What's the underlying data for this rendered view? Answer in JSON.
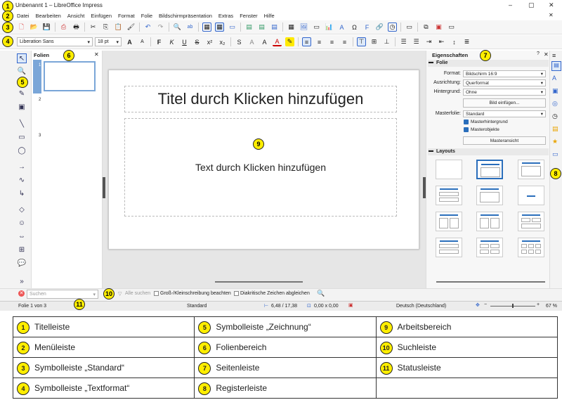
{
  "window": {
    "title": "Unbenannt 1 – LibreOffice Impress",
    "controls": [
      "–",
      "▢",
      "✕"
    ]
  },
  "menu": [
    "Datei",
    "Bearbeiten",
    "Ansicht",
    "Einfügen",
    "Format",
    "Folie",
    "Bildschirmpräsentation",
    "Extras",
    "Fenster",
    "Hilfe"
  ],
  "textformat": {
    "font": "Liberation Sans",
    "size": "18 pt"
  },
  "slidepane": {
    "title": "Folien",
    "numbers": [
      "1",
      "2",
      "3"
    ]
  },
  "slide": {
    "title_placeholder": "Titel durch Klicken hinzufügen",
    "text_placeholder": "Text durch Klicken hinzufügen"
  },
  "sidebar": {
    "title": "Eigenschaften",
    "folie_header": "Folie",
    "format_label": "Format:",
    "format_value": "Bildschirm 16:9",
    "ausrichtung_label": "Ausrichtung:",
    "ausrichtung_value": "Querformat",
    "hintergrund_label": "Hintergrund:",
    "hintergrund_value": "Ohne",
    "bild_button": "Bild einfügen...",
    "masterfolie_label": "Masterfolie:",
    "masterfolie_value": "Standard",
    "check1": "Masterhintergrund",
    "check2": "Masterobjekte",
    "masteransicht_button": "Masteransicht",
    "layouts_header": "Layouts"
  },
  "findbar": {
    "placeholder": "Suchen",
    "alle_suchen": "Alle suchen",
    "opt1": "Groß-/Kleinschreibung beachten",
    "opt2": "Diakritische Zeichen abgleichen"
  },
  "status": {
    "slide": "Folie 1 von 3",
    "master": "Standard",
    "pos": "6,48 / 17,38",
    "size": "0,00 x 0,00",
    "lang": "Deutsch (Deutschland)",
    "zoom": "67 %"
  },
  "badges": [
    "1",
    "2",
    "3",
    "4",
    "5",
    "6",
    "7",
    "8",
    "9",
    "10",
    "11"
  ],
  "legend": [
    [
      "Titelleiste",
      "Symbolleiste „Zeichnung“",
      "Arbeitsbereich"
    ],
    [
      "Menüleiste",
      "Folienbereich",
      "Suchleiste"
    ],
    [
      "Symbolleiste „Standard“",
      "Seitenleiste",
      "Statusleiste"
    ],
    [
      "Symbolleiste „Textformat“",
      "Registerleiste",
      ""
    ]
  ],
  "legend_nums": [
    [
      "1",
      "5",
      "9"
    ],
    [
      "2",
      "6",
      "10"
    ],
    [
      "3",
      "7",
      "11"
    ],
    [
      "4",
      "8",
      ""
    ]
  ]
}
